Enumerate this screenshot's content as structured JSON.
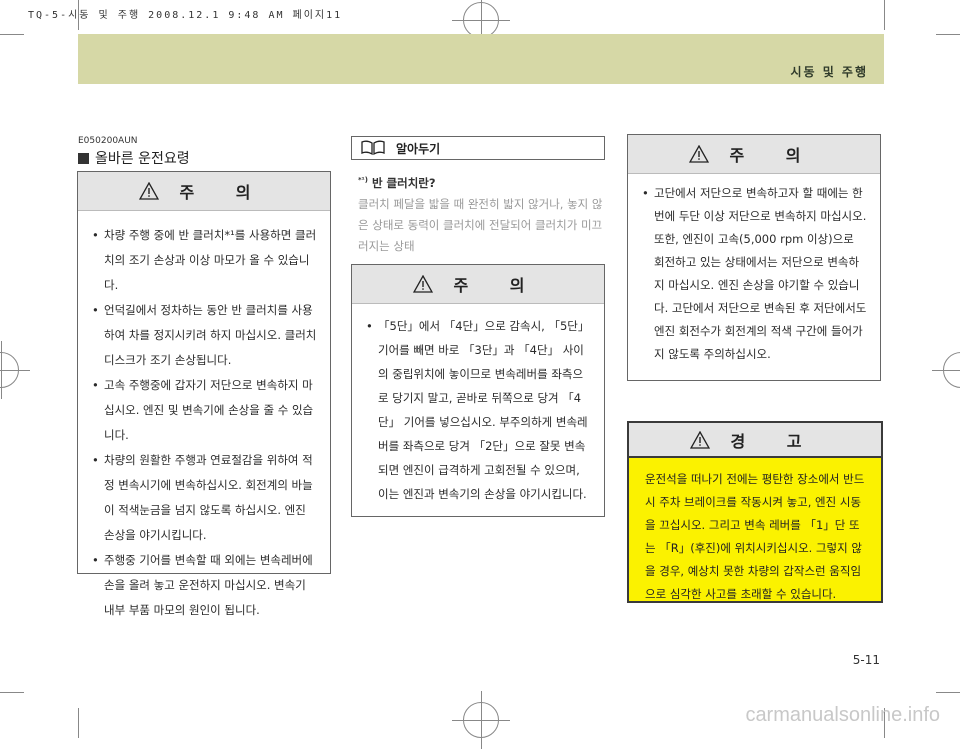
{
  "print_header": "TQ-5-시동 및 주행  2008.12.1 9:48 AM 페이지11",
  "section_title": "시동 및 주행",
  "code": "E050200AUN",
  "heading": "올바른 운전요령",
  "caution_left": {
    "title": "주 의",
    "items": [
      "차량 주행 중에 반 클러치*¹를 사용하면 클러치의 조기 손상과 이상 마모가 올 수 있습니다.",
      "언덕길에서 정차하는 동안 반 클러치를 사용하여 차를 정지시키려 하지 마십시오. 클러치 디스크가 조기 손상됩니다.",
      "고속 주행중에 갑자기 저단으로 변속하지 마십시오. 엔진 및 변속기에 손상을 줄 수 있습니다.",
      "차량의 원활한 주행과 연료절감을 위하여 적정 변속시기에 변속하십시오. 회전계의 바늘이 적색눈금을 넘지 않도록 하십시오. 엔진 손상을 야기시킵니다.",
      "주행중 기어를 변속할 때 외에는 변속레버에 손을 올려 놓고 운전하지 마십시오. 변속기 내부 부품 마모의 원인이 됩니다."
    ]
  },
  "note": {
    "label": "알아두기",
    "term": "반 클러치란?",
    "term_mark": "*¹)",
    "body": "클러치 페달을 밟을 때 완전히 밟지 않거나, 놓지 않은 상태로 동력이 클러치에 전달되어 클러치가 미끄러지는 상태"
  },
  "caution_middle": {
    "title": "주 의",
    "items": [
      "「5단」에서 「4단」으로 감속시, 「5단」 기어를 빼면 바로 「3단」과 「4단」 사이의 중립위치에 놓이므로 변속레버를 좌측으로 당기지 말고, 곧바로 뒤쪽으로 당겨 「4단」 기어를 넣으십시오. 부주의하게 변속레버를 좌측으로 당겨 「2단」으로 잘못 변속되면 엔진이 급격하게 고회전될 수 있으며, 이는 엔진과 변속기의 손상을 야기시킵니다."
    ]
  },
  "caution_right": {
    "title": "주 의",
    "items": [
      "고단에서 저단으로 변속하고자 할 때에는 한번에 두단 이상 저단으로 변속하지 마십시오. 또한, 엔진이 고속(5,000 rpm 이상)으로 회전하고 있는 상태에서는 저단으로 변속하지 마십시오. 엔진 손상을 야기할 수 있습니다. 고단에서 저단으로 변속된 후 저단에서도 엔진 회전수가 회전계의 적색 구간에 들어가지 않도록 주의하십시오."
    ]
  },
  "warning": {
    "title": "경 고",
    "text": "운전석을 떠나기 전에는 평탄한 장소에서 반드시 주차 브레이크를 작동시켜 놓고, 엔진 시동을 끄십시오. 그리고 변속 레버를 「1」단 또는 「R」(후진)에 위치시키십시오. 그렇지 않을 경우, 예상치 못한 차량의 갑작스런 움직임으로 심각한 사고를 초래할 수 있습니다."
  },
  "page_number": "5-11",
  "watermark": "carmanualsonline.info"
}
